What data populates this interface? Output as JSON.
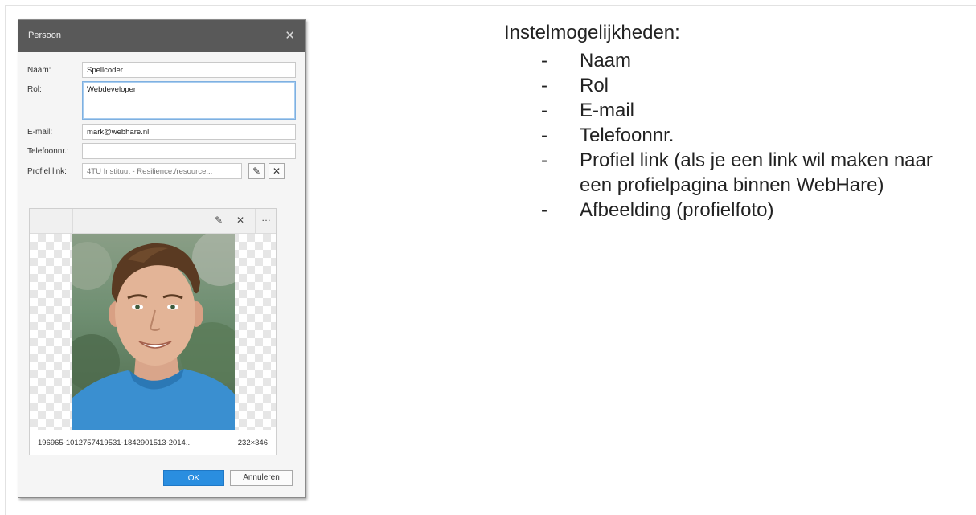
{
  "dialog": {
    "title": "Persoon",
    "fields": {
      "naam": {
        "label": "Naam:",
        "value": "Spellcoder"
      },
      "rol": {
        "label": "Rol:",
        "value": "Webdeveloper"
      },
      "email": {
        "label": "E-mail:",
        "value": "mark@webhare.nl"
      },
      "telefoon": {
        "label": "Telefoonnr.:",
        "value": ""
      },
      "profiel": {
        "label": "Profiel link:",
        "value": "4TU Instituut - Resilience:/resource..."
      }
    },
    "image": {
      "filename": "196965-1012757419531-1842901513-2014...",
      "dimensions": "232×346"
    },
    "buttons": {
      "ok": "OK",
      "cancel": "Annuleren"
    }
  },
  "notes": {
    "heading": "Instelmogelijkheden:",
    "items": [
      "Naam",
      "Rol",
      "E-mail",
      "Telefoonnr.",
      "Profiel link (als je een link wil maken naar een profielpagina binnen WebHare)",
      "Afbeelding (profielfoto)"
    ]
  },
  "icons": {
    "close": "close-icon",
    "edit": "pencil-icon",
    "clear": "x-icon",
    "more": "ellipsis-icon"
  }
}
